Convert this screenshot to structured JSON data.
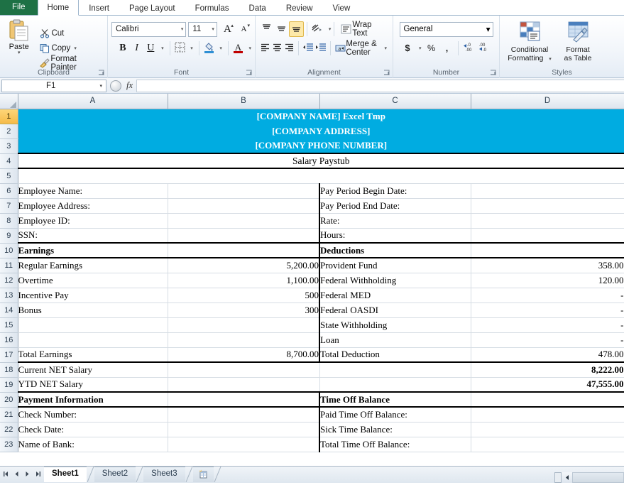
{
  "ribbon": {
    "tabs": [
      {
        "label": "File",
        "type": "file"
      },
      {
        "label": "Home",
        "active": true
      },
      {
        "label": "Insert"
      },
      {
        "label": "Page Layout"
      },
      {
        "label": "Formulas"
      },
      {
        "label": "Data"
      },
      {
        "label": "Review"
      },
      {
        "label": "View"
      }
    ],
    "clipboard": {
      "group_label": "Clipboard",
      "paste_label": "Paste",
      "cut_label": "Cut",
      "copy_label": "Copy",
      "format_painter_label": "Format Painter",
      "icons": {
        "paste": "clipboard-icon",
        "cut": "scissors-icon",
        "copy": "copy-icon",
        "format_painter": "paintbrush-icon"
      }
    },
    "font": {
      "group_label": "Font",
      "font_name": "Calibri",
      "font_size": "11",
      "grow_font": "A",
      "shrink_font": "A",
      "bold": "B",
      "italic": "I",
      "underline": "U",
      "borders_icon": "borders-icon",
      "fill_color_icon": "fill-color-icon",
      "font_color_icon": "font-color-icon"
    },
    "alignment": {
      "group_label": "Alignment",
      "wrap_text_label": "Wrap Text",
      "merge_center_label": "Merge & Center",
      "top_align_icon": "align-top-icon",
      "middle_align_icon": "align-middle-icon",
      "bottom_align_icon": "align-bottom-icon",
      "left_align_icon": "align-left-icon",
      "center_align_icon": "align-center-icon",
      "right_align_icon": "align-right-icon",
      "orientation_icon": "text-orientation-icon",
      "decrease_indent_icon": "decrease-indent-icon",
      "increase_indent_icon": "increase-indent-icon"
    },
    "number": {
      "group_label": "Number",
      "format": "General",
      "currency": "$",
      "percent": "%",
      "comma": ",",
      "increase_decimal_icon": "increase-decimal-icon",
      "decrease_decimal_icon": "decrease-decimal-icon"
    },
    "styles": {
      "group_label": "Styles",
      "conditional_formatting_line1": "Conditional",
      "conditional_formatting_line2": "Formatting",
      "format_as_table_line1": "Format",
      "format_as_table_line2": "as Table"
    }
  },
  "formula_bar": {
    "name_box": "F1",
    "fx_label": "fx",
    "formula_value": ""
  },
  "sheet": {
    "columns": [
      "A",
      "B",
      "C",
      "D"
    ],
    "rows": [
      {
        "n": "1",
        "type": "banner",
        "text": "[COMPANY NAME] Excel Tmp"
      },
      {
        "n": "2",
        "type": "banner",
        "text": "[COMPANY ADDRESS]"
      },
      {
        "n": "3",
        "type": "banner",
        "text": "[COMPANY PHONE NUMBER]"
      },
      {
        "n": "4",
        "type": "title",
        "text": "Salary Paystub"
      },
      {
        "n": "5",
        "type": "blank",
        "a": "",
        "b": "",
        "c": "",
        "d": ""
      },
      {
        "n": "6",
        "type": "data",
        "a": "Employee Name:",
        "b": "",
        "c": "Pay Period Begin Date:",
        "d": ""
      },
      {
        "n": "7",
        "type": "data",
        "a": "Employee Address:",
        "b": "",
        "c": "Pay Period End Date:",
        "d": ""
      },
      {
        "n": "8",
        "type": "data",
        "a": "Employee ID:",
        "b": "",
        "c": "Rate:",
        "d": ""
      },
      {
        "n": "9",
        "type": "data",
        "a": "SSN:",
        "b": "",
        "c": "Hours:",
        "d": ""
      },
      {
        "n": "10",
        "type": "header",
        "a": "Earnings",
        "b": "",
        "c": "Deductions",
        "d": ""
      },
      {
        "n": "11",
        "type": "data",
        "a": "Regular Earnings",
        "b": "5,200.00",
        "c": "Provident Fund",
        "d": "358.00"
      },
      {
        "n": "12",
        "type": "data",
        "a": "Overtime",
        "b": "1,100.00",
        "c": "Federal Withholding",
        "d": "120.00"
      },
      {
        "n": "13",
        "type": "data",
        "a": "Incentive Pay",
        "b": "500",
        "c": "Federal MED",
        "d": "-"
      },
      {
        "n": "14",
        "type": "data",
        "a": "Bonus",
        "b": "300",
        "c": "Federal OASDI",
        "d": "-"
      },
      {
        "n": "15",
        "type": "data",
        "a": "",
        "b": "",
        "c": "State Withholding",
        "d": "-"
      },
      {
        "n": "16",
        "type": "data",
        "a": "",
        "b": "",
        "c": "Loan",
        "d": "-"
      },
      {
        "n": "17",
        "type": "total",
        "a": "Total Earnings",
        "b": "8,700.00",
        "c": "Total Deduction",
        "d": "478.00"
      },
      {
        "n": "18",
        "type": "net",
        "a": "Current NET Salary",
        "b": "",
        "c": "",
        "d": "8,222.00"
      },
      {
        "n": "19",
        "type": "net",
        "a": "YTD NET Salary",
        "b": "",
        "c": "",
        "d": "47,555.00"
      },
      {
        "n": "20",
        "type": "header",
        "a": "Payment Information",
        "b": "",
        "c": "Time Off Balance",
        "d": ""
      },
      {
        "n": "21",
        "type": "data",
        "a": "Check  Number:",
        "b": "",
        "c": "Paid Time Off Balance:",
        "d": ""
      },
      {
        "n": "22",
        "type": "data",
        "a": "Check Date:",
        "b": "",
        "c": "Sick Time Balance:",
        "d": ""
      },
      {
        "n": "23",
        "type": "data",
        "a": "Name of Bank:",
        "b": "",
        "c": "Total Time Off Balance:",
        "d": ""
      }
    ],
    "banner_color": "#00ace1",
    "active_row": "1"
  },
  "sheet_tabs": {
    "tabs": [
      {
        "label": "Sheet1",
        "active": true
      },
      {
        "label": "Sheet2",
        "active": false
      },
      {
        "label": "Sheet3",
        "active": false
      }
    ],
    "insert_sheet_icon": "new-sheet-icon",
    "nav_first": "first-sheet-icon",
    "nav_prev": "previous-sheet-icon",
    "nav_next": "next-sheet-icon",
    "nav_last": "last-sheet-icon"
  }
}
